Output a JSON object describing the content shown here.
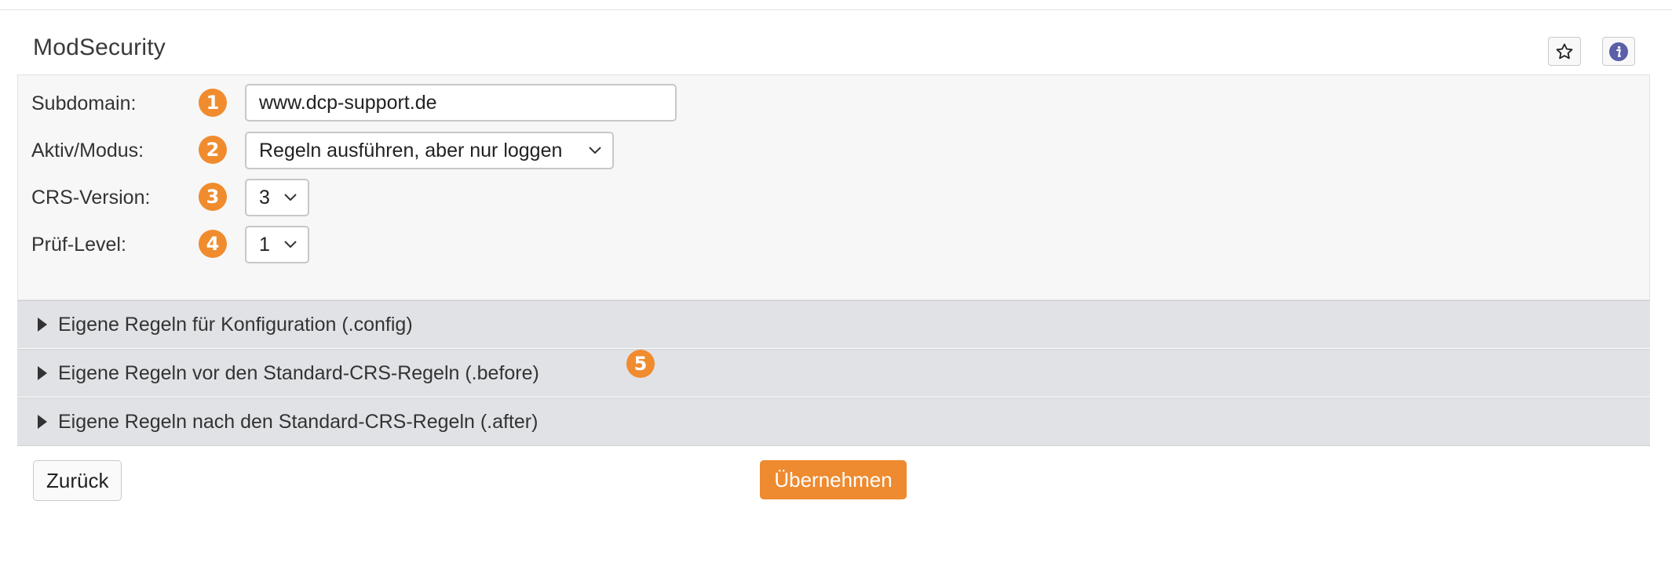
{
  "header": {
    "title": "ModSecurity",
    "favorite_icon": "star-icon",
    "info_icon": "info-icon"
  },
  "form": {
    "subdomain": {
      "label": "Subdomain:",
      "marker": "1",
      "value": "www.dcp-support.de"
    },
    "mode": {
      "label": "Aktiv/Modus:",
      "marker": "2",
      "selected": "Regeln ausführen, aber nur loggen"
    },
    "crs_version": {
      "label": "CRS-Version:",
      "marker": "3",
      "selected": "3"
    },
    "level": {
      "label": "Prüf-Level:",
      "marker": "4",
      "selected": "1"
    }
  },
  "accordion": {
    "marker": "5",
    "items": [
      {
        "label": "Eigene Regeln für Konfiguration (.config)"
      },
      {
        "label": "Eigene Regeln vor den Standard-CRS-Regeln (.before)"
      },
      {
        "label": "Eigene Regeln nach den Standard-CRS-Regeln (.after)"
      }
    ]
  },
  "actions": {
    "back_label": "Zurück",
    "apply_label": "Übernehmen"
  },
  "colors": {
    "accent": "#ee8a2f",
    "info": "#5b5fa8",
    "panel": "#f7f7f7",
    "accordion": "#e1e2e6"
  }
}
